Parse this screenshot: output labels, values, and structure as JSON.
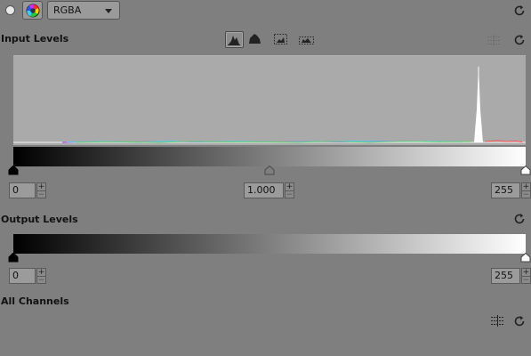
{
  "toolbar": {
    "channel": "RGBA",
    "colorwheel_icon": "color-wheel-icon"
  },
  "input_levels": {
    "title": "Input Levels",
    "black_value": "0",
    "gamma_value": "1.000",
    "white_value": "255",
    "histogram_modes": [
      "histogram-linear-icon",
      "histogram-log-icon",
      "histogram-per-channel-icon",
      "histogram-none-icon"
    ],
    "histogram_colors": {
      "background": "#aaaaaa",
      "peak": "#ffffff"
    }
  },
  "output_levels": {
    "title": "Output Levels",
    "black_value": "0",
    "white_value": "255"
  },
  "all_channels": {
    "title": "All Channels"
  },
  "spinner": {
    "plus": "+",
    "minus": "−"
  }
}
